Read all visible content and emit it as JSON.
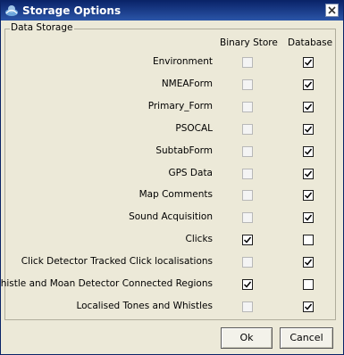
{
  "window": {
    "title": "Storage Options"
  },
  "group": {
    "legend": "Data Storage",
    "col_binary": "Binary Store",
    "col_database": "Database"
  },
  "rows": [
    {
      "label": "Environment",
      "binary_enabled": false,
      "binary_checked": false,
      "database_checked": true
    },
    {
      "label": "NMEAForm",
      "binary_enabled": false,
      "binary_checked": false,
      "database_checked": true
    },
    {
      "label": "Primary_Form",
      "binary_enabled": false,
      "binary_checked": false,
      "database_checked": true
    },
    {
      "label": "PSOCAL",
      "binary_enabled": false,
      "binary_checked": false,
      "database_checked": true
    },
    {
      "label": "SubtabForm",
      "binary_enabled": false,
      "binary_checked": false,
      "database_checked": true
    },
    {
      "label": "GPS Data",
      "binary_enabled": false,
      "binary_checked": false,
      "database_checked": true
    },
    {
      "label": "Map Comments",
      "binary_enabled": false,
      "binary_checked": false,
      "database_checked": true
    },
    {
      "label": "Sound Acquisition",
      "binary_enabled": false,
      "binary_checked": false,
      "database_checked": true
    },
    {
      "label": "Clicks",
      "binary_enabled": true,
      "binary_checked": true,
      "database_checked": false
    },
    {
      "label": "Click Detector Tracked Click localisations",
      "binary_enabled": false,
      "binary_checked": false,
      "database_checked": true
    },
    {
      "label": "Whistle and Moan Detector Connected Regions",
      "binary_enabled": true,
      "binary_checked": true,
      "database_checked": false
    },
    {
      "label": "Localised Tones and Whistles",
      "binary_enabled": false,
      "binary_checked": false,
      "database_checked": true
    }
  ],
  "buttons": {
    "ok": "Ok",
    "cancel": "Cancel"
  }
}
